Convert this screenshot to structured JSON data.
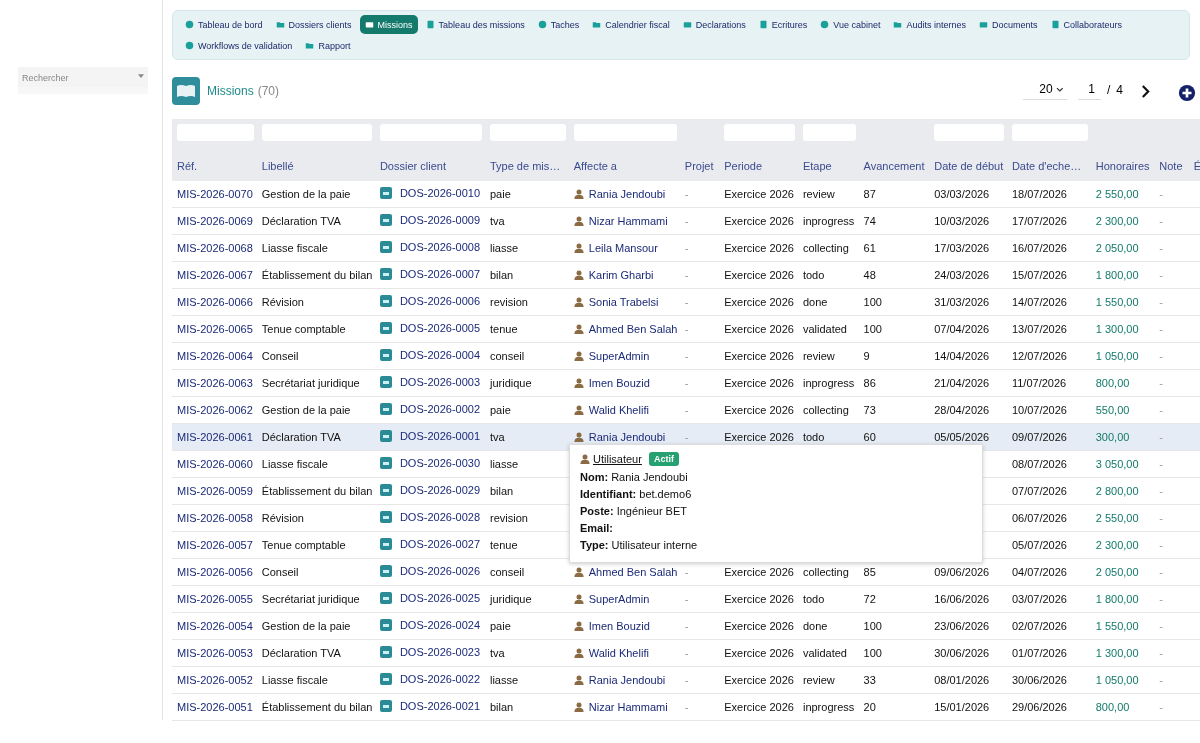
{
  "sidebar": {
    "search": {
      "placeholder": "Rechercher"
    }
  },
  "nav": [
    {
      "label": "Tableau de bord",
      "selected": false
    },
    {
      "label": "Dossiers clients",
      "selected": false
    },
    {
      "label": "Missions",
      "selected": true
    },
    {
      "label": "Tableau des missions",
      "selected": false
    },
    {
      "label": "Taches",
      "selected": false
    },
    {
      "label": "Calendrier fiscal",
      "selected": false
    },
    {
      "label": "Declarations",
      "selected": false
    },
    {
      "label": "Ecritures",
      "selected": false
    },
    {
      "label": "Vue cabinet",
      "selected": false
    },
    {
      "label": "Audits internes",
      "selected": false
    },
    {
      "label": "Documents",
      "selected": false
    },
    {
      "label": "Collaborateurs",
      "selected": false
    },
    {
      "label": "Workflows de validation",
      "selected": false
    },
    {
      "label": "Rapport",
      "selected": false
    }
  ],
  "header": {
    "title": "Missions",
    "count": "(70)",
    "page_size": "20",
    "page": "1",
    "separator": "/",
    "pages": "4"
  },
  "table": {
    "columns": [
      {
        "label": "Réf.",
        "filter": true
      },
      {
        "label": "Libellé",
        "filter": true
      },
      {
        "label": "Dossier client",
        "filter": true
      },
      {
        "label": "Type de mis…",
        "filter": true
      },
      {
        "label": "Affecte a",
        "filter": true
      },
      {
        "label": "Projet",
        "filter": false
      },
      {
        "label": "Periode",
        "filter": true
      },
      {
        "label": "Etape",
        "filter": true
      },
      {
        "label": "Avancement",
        "filter": false
      },
      {
        "label": "Date de début",
        "filter": true
      },
      {
        "label": "Date d'eche…",
        "filter": true
      },
      {
        "label": "Honoraires",
        "filter": false
      },
      {
        "label": "Note",
        "filter": false
      },
      {
        "label": "É",
        "filter": false
      }
    ],
    "rows": [
      {
        "selected": false,
        "ref": "MIS-2026-0070",
        "label": "Gestion de la paie",
        "dossier": "DOS-2026-0010",
        "type": "paie",
        "assignee": "Rania Jendoubi",
        "project": "-",
        "period": "Exercice 2026",
        "stage": "review",
        "progress": "87",
        "start": "03/03/2026",
        "due": "18/07/2026",
        "fees": "2 550,00",
        "note": "-"
      },
      {
        "selected": false,
        "ref": "MIS-2026-0069",
        "label": "Déclaration TVA",
        "dossier": "DOS-2026-0009",
        "type": "tva",
        "assignee": "Nizar Hammami",
        "project": "-",
        "period": "Exercice 2026",
        "stage": "inprogress",
        "progress": "74",
        "start": "10/03/2026",
        "due": "17/07/2026",
        "fees": "2 300,00",
        "note": "-"
      },
      {
        "selected": false,
        "ref": "MIS-2026-0068",
        "label": "Liasse fiscale",
        "dossier": "DOS-2026-0008",
        "type": "liasse",
        "assignee": "Leila Mansour",
        "project": "-",
        "period": "Exercice 2026",
        "stage": "collecting",
        "progress": "61",
        "start": "17/03/2026",
        "due": "16/07/2026",
        "fees": "2 050,00",
        "note": "-"
      },
      {
        "selected": false,
        "ref": "MIS-2026-0067",
        "label": "Établissement du bilan",
        "dossier": "DOS-2026-0007",
        "type": "bilan",
        "assignee": "Karim Gharbi",
        "project": "-",
        "period": "Exercice 2026",
        "stage": "todo",
        "progress": "48",
        "start": "24/03/2026",
        "due": "15/07/2026",
        "fees": "1 800,00",
        "note": "-"
      },
      {
        "selected": false,
        "ref": "MIS-2026-0066",
        "label": "Révision",
        "dossier": "DOS-2026-0006",
        "type": "revision",
        "assignee": "Sonia Trabelsi",
        "project": "-",
        "period": "Exercice 2026",
        "stage": "done",
        "progress": "100",
        "start": "31/03/2026",
        "due": "14/07/2026",
        "fees": "1 550,00",
        "note": "-"
      },
      {
        "selected": false,
        "ref": "MIS-2026-0065",
        "label": "Tenue comptable",
        "dossier": "DOS-2026-0005",
        "type": "tenue",
        "assignee": "Ahmed Ben Salah",
        "project": "-",
        "period": "Exercice 2026",
        "stage": "validated",
        "progress": "100",
        "start": "07/04/2026",
        "due": "13/07/2026",
        "fees": "1 300,00",
        "note": "-"
      },
      {
        "selected": false,
        "ref": "MIS-2026-0064",
        "label": "Conseil",
        "dossier": "DOS-2026-0004",
        "type": "conseil",
        "assignee": "SuperAdmin",
        "project": "-",
        "period": "Exercice 2026",
        "stage": "review",
        "progress": "9",
        "start": "14/04/2026",
        "due": "12/07/2026",
        "fees": "1 050,00",
        "note": "-"
      },
      {
        "selected": false,
        "ref": "MIS-2026-0063",
        "label": "Secrétariat juridique",
        "dossier": "DOS-2026-0003",
        "type": "juridique",
        "assignee": "Imen Bouzid",
        "project": "-",
        "period": "Exercice 2026",
        "stage": "inprogress",
        "progress": "86",
        "start": "21/04/2026",
        "due": "11/07/2026",
        "fees": "800,00",
        "note": "-"
      },
      {
        "selected": false,
        "ref": "MIS-2026-0062",
        "label": "Gestion de la paie",
        "dossier": "DOS-2026-0002",
        "type": "paie",
        "assignee": "Walid Khelifi",
        "project": "-",
        "period": "Exercice 2026",
        "stage": "collecting",
        "progress": "73",
        "start": "28/04/2026",
        "due": "10/07/2026",
        "fees": "550,00",
        "note": "-"
      },
      {
        "selected": true,
        "ref": "MIS-2026-0061",
        "label": "Déclaration TVA",
        "dossier": "DOS-2026-0001",
        "type": "tva",
        "assignee": "Rania Jendoubi",
        "project": "-",
        "period": "Exercice 2026",
        "stage": "todo",
        "progress": "60",
        "start": "05/05/2026",
        "due": "09/07/2026",
        "fees": "300,00",
        "note": "-"
      },
      {
        "selected": false,
        "ref": "MIS-2026-0060",
        "label": "Liasse fiscale",
        "dossier": "DOS-2026-0030",
        "type": "liasse",
        "due": "08/07/2026",
        "fees": "3 050,00",
        "note": "-"
      },
      {
        "selected": false,
        "ref": "MIS-2026-0059",
        "label": "Établissement du bilan",
        "dossier": "DOS-2026-0029",
        "type": "bilan",
        "due": "07/07/2026",
        "fees": "2 800,00",
        "note": "-"
      },
      {
        "selected": false,
        "ref": "MIS-2026-0058",
        "label": "Révision",
        "dossier": "DOS-2026-0028",
        "type": "revision",
        "due": "06/07/2026",
        "fees": "2 550,00",
        "note": "-"
      },
      {
        "selected": false,
        "ref": "MIS-2026-0057",
        "label": "Tenue comptable",
        "dossier": "DOS-2026-0027",
        "type": "tenue",
        "due": "05/07/2026",
        "fees": "2 300,00",
        "note": "-"
      },
      {
        "selected": false,
        "ref": "MIS-2026-0056",
        "label": "Conseil",
        "dossier": "DOS-2026-0026",
        "type": "conseil",
        "assignee": "Ahmed Ben Salah",
        "project": "-",
        "period": "Exercice 2026",
        "stage": "collecting",
        "progress": "85",
        "start": "09/06/2026",
        "due": "04/07/2026",
        "fees": "2 050,00",
        "note": "-"
      },
      {
        "selected": false,
        "ref": "MIS-2026-0055",
        "label": "Secrétariat juridique",
        "dossier": "DOS-2026-0025",
        "type": "juridique",
        "assignee": "SuperAdmin",
        "project": "-",
        "period": "Exercice 2026",
        "stage": "todo",
        "progress": "72",
        "start": "16/06/2026",
        "due": "03/07/2026",
        "fees": "1 800,00",
        "note": "-"
      },
      {
        "selected": false,
        "ref": "MIS-2026-0054",
        "label": "Gestion de la paie",
        "dossier": "DOS-2026-0024",
        "type": "paie",
        "assignee": "Imen Bouzid",
        "project": "-",
        "period": "Exercice 2026",
        "stage": "done",
        "progress": "100",
        "start": "23/06/2026",
        "due": "02/07/2026",
        "fees": "1 550,00",
        "note": "-"
      },
      {
        "selected": false,
        "ref": "MIS-2026-0053",
        "label": "Déclaration TVA",
        "dossier": "DOS-2026-0023",
        "type": "tva",
        "assignee": "Walid Khelifi",
        "project": "-",
        "period": "Exercice 2026",
        "stage": "validated",
        "progress": "100",
        "start": "30/06/2026",
        "due": "01/07/2026",
        "fees": "1 300,00",
        "note": "-"
      },
      {
        "selected": false,
        "ref": "MIS-2026-0052",
        "label": "Liasse fiscale",
        "dossier": "DOS-2026-0022",
        "type": "liasse",
        "assignee": "Rania Jendoubi",
        "project": "-",
        "period": "Exercice 2026",
        "stage": "review",
        "progress": "33",
        "start": "08/01/2026",
        "due": "30/06/2026",
        "fees": "1 050,00",
        "note": "-"
      },
      {
        "selected": false,
        "ref": "MIS-2026-0051",
        "label": "Établissement du bilan",
        "dossier": "DOS-2026-0021",
        "type": "bilan",
        "assignee": "Nizar Hammami",
        "project": "-",
        "period": "Exercice 2026",
        "stage": "inprogress",
        "progress": "20",
        "start": "15/01/2026",
        "due": "29/06/2026",
        "fees": "800,00",
        "note": "-"
      }
    ]
  },
  "popover": {
    "title": "Utilisateur",
    "status": "Actif",
    "fields": [
      {
        "label": "Nom:",
        "value": "Rania Jendoubi"
      },
      {
        "label": "Identifiant:",
        "value": "bet.demo6"
      },
      {
        "label": "Poste:",
        "value": "Ingénieur BET"
      },
      {
        "label": "Email:"
      },
      {
        "label": "Type:",
        "value": "Utilisateur interne"
      }
    ]
  }
}
